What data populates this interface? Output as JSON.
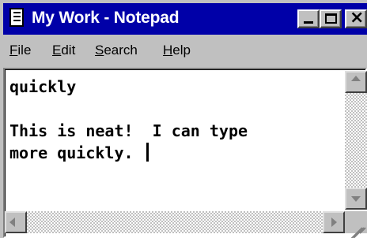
{
  "window": {
    "title": "My Work - Notepad"
  },
  "menu": {
    "file": {
      "accel": "F",
      "rest": "ile"
    },
    "edit": {
      "accel": "E",
      "rest": "dit"
    },
    "search": {
      "accel": "S",
      "rest": "earch"
    },
    "help": {
      "accel": "H",
      "rest": "elp"
    }
  },
  "document": {
    "lines": [
      "quickly",
      "",
      "This is neat!  I can type",
      "more quickly. "
    ]
  },
  "icons": {
    "app": "notepad-icon",
    "minimize": "minimize-icon",
    "maximize": "maximize-icon",
    "close": "close-icon",
    "scroll_up": "arrow-up-icon",
    "scroll_down": "arrow-down-icon",
    "scroll_left": "arrow-left-icon",
    "scroll_right": "arrow-right-icon",
    "resize": "size-grip-icon"
  },
  "colors": {
    "titlebar": "#0000a8",
    "face": "#c0c0c0",
    "text": "#000000"
  }
}
